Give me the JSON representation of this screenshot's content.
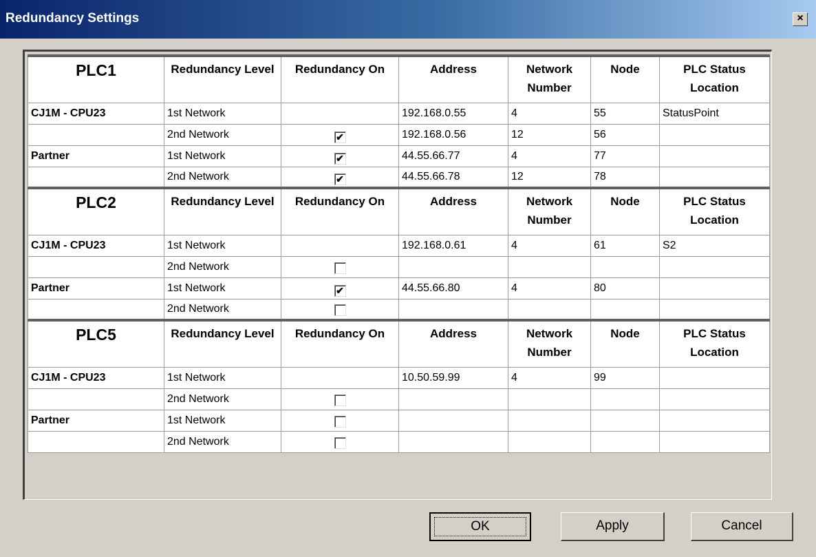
{
  "window": {
    "title": "Redundancy Settings",
    "close_label": "×"
  },
  "columns": [
    "Redundancy Level",
    "Redundancy On",
    "Address",
    "Network Number",
    "Node",
    "PLC Status Location"
  ],
  "groups": [
    {
      "name": "PLC1",
      "rows": [
        {
          "device": "CJ1M - CPU23",
          "level": "1st Network",
          "has_checkbox": false,
          "checked": false,
          "address": "192.168.0.55",
          "network": "4",
          "node": "55",
          "status": "StatusPoint"
        },
        {
          "device": "",
          "level": "2nd Network",
          "has_checkbox": true,
          "checked": true,
          "address": "192.168.0.56",
          "network": "12",
          "node": "56",
          "status": ""
        },
        {
          "device": "Partner",
          "level": "1st Network",
          "has_checkbox": true,
          "checked": true,
          "address": "44.55.66.77",
          "network": "4",
          "node": "77",
          "status": ""
        },
        {
          "device": "",
          "level": "2nd Network",
          "has_checkbox": true,
          "checked": true,
          "address": "44.55.66.78",
          "network": "12",
          "node": "78",
          "status": ""
        }
      ]
    },
    {
      "name": "PLC2",
      "rows": [
        {
          "device": "CJ1M - CPU23",
          "level": "1st Network",
          "has_checkbox": false,
          "checked": false,
          "address": "192.168.0.61",
          "network": "4",
          "node": "61",
          "status": "S2"
        },
        {
          "device": "",
          "level": "2nd Network",
          "has_checkbox": true,
          "checked": false,
          "address": "",
          "network": "",
          "node": "",
          "status": ""
        },
        {
          "device": "Partner",
          "level": "1st Network",
          "has_checkbox": true,
          "checked": true,
          "address": "44.55.66.80",
          "network": "4",
          "node": "80",
          "status": ""
        },
        {
          "device": "",
          "level": "2nd Network",
          "has_checkbox": true,
          "checked": false,
          "address": "",
          "network": "",
          "node": "",
          "status": ""
        }
      ]
    },
    {
      "name": "PLC5",
      "rows": [
        {
          "device": "CJ1M - CPU23",
          "level": "1st Network",
          "has_checkbox": false,
          "checked": false,
          "address": "10.50.59.99",
          "network": "4",
          "node": "99",
          "status": ""
        },
        {
          "device": "",
          "level": "2nd Network",
          "has_checkbox": true,
          "checked": false,
          "address": "",
          "network": "",
          "node": "",
          "status": ""
        },
        {
          "device": "Partner",
          "level": "1st Network",
          "has_checkbox": true,
          "checked": false,
          "address": "",
          "network": "",
          "node": "",
          "status": ""
        },
        {
          "device": "",
          "level": "2nd Network",
          "has_checkbox": true,
          "checked": false,
          "address": "",
          "network": "",
          "node": "",
          "status": ""
        }
      ]
    }
  ],
  "buttons": {
    "ok": "OK",
    "apply": "Apply",
    "cancel": "Cancel"
  }
}
